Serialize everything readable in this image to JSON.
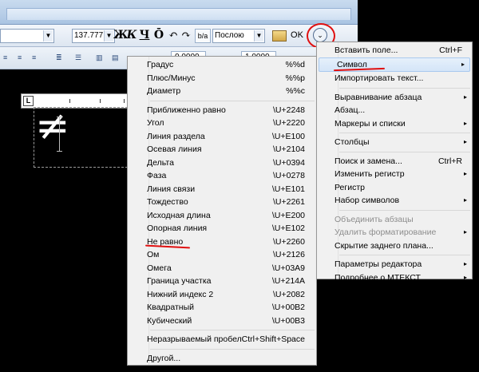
{
  "toolbar": {
    "font_size": "137.777",
    "bold_glyph": "Ж",
    "italic_glyph": "К",
    "underline_glyph": "Ч",
    "overline_glyph": "Ō",
    "undo_glyph": "↶",
    "redo_glyph": "↷",
    "stack_glyph": "b/a",
    "layer": "Послою",
    "ok_label": "OK",
    "options_glyph": "⌄",
    "field1": "0.0000",
    "field2": "1.0000"
  },
  "editor": {
    "ruler_corner": "L",
    "symbol_glyph": "≠"
  },
  "symbol_menu": {
    "items": [
      {
        "label": "Градус",
        "shortcut": "%%d"
      },
      {
        "label": "Плюс/Минус",
        "shortcut": "%%p"
      },
      {
        "label": "Диаметр",
        "shortcut": "%%c"
      },
      {
        "label": "Приближенно равно",
        "shortcut": "\\U+2248"
      },
      {
        "label": "Угол",
        "shortcut": "\\U+2220"
      },
      {
        "label": "Линия раздела",
        "shortcut": "\\U+E100"
      },
      {
        "label": "Осевая линия",
        "shortcut": "\\U+2104"
      },
      {
        "label": "Дельта",
        "shortcut": "\\U+0394"
      },
      {
        "label": "Фаза",
        "shortcut": "\\U+0278"
      },
      {
        "label": "Линия связи",
        "shortcut": "\\U+E101"
      },
      {
        "label": "Тождество",
        "shortcut": "\\U+2261"
      },
      {
        "label": "Исходная длина",
        "shortcut": "\\U+E200"
      },
      {
        "label": "Опорная линия",
        "shortcut": "\\U+E102"
      },
      {
        "label": "Не равно",
        "shortcut": "\\U+2260"
      },
      {
        "label": "Ом",
        "shortcut": "\\U+2126"
      },
      {
        "label": "Омега",
        "shortcut": "\\U+03A9"
      },
      {
        "label": "Граница участка",
        "shortcut": "\\U+214A"
      },
      {
        "label": "Нижний индекс 2",
        "shortcut": "\\U+2082"
      },
      {
        "label": "Квадратный",
        "shortcut": "\\U+00B2"
      },
      {
        "label": "Кубический",
        "shortcut": "\\U+00B3"
      },
      {
        "label": "Неразрываемый пробел",
        "shortcut": "Ctrl+Shift+Space"
      },
      {
        "label": "Другой...",
        "shortcut": ""
      }
    ]
  },
  "main_menu": {
    "items": [
      {
        "label": "Вставить поле...",
        "shortcut": "Ctrl+F",
        "sub": ""
      },
      {
        "label": "Символ",
        "shortcut": "",
        "sub": "▸"
      },
      {
        "label": "Импортировать текст...",
        "shortcut": "",
        "sub": ""
      },
      {
        "label": "Выравнивание абзаца",
        "shortcut": "",
        "sub": "▸"
      },
      {
        "label": "Абзац...",
        "shortcut": "",
        "sub": ""
      },
      {
        "label": "Маркеры и списки",
        "shortcut": "",
        "sub": "▸"
      },
      {
        "label": "Столбцы",
        "shortcut": "",
        "sub": "▸"
      },
      {
        "label": "Поиск и замена...",
        "shortcut": "Ctrl+R",
        "sub": ""
      },
      {
        "label": "Изменить регистр",
        "shortcut": "",
        "sub": "▸"
      },
      {
        "label": "Регистр",
        "shortcut": "",
        "sub": ""
      },
      {
        "label": "Набор символов",
        "shortcut": "",
        "sub": "▸"
      },
      {
        "label": "Объединить абзацы",
        "shortcut": "",
        "sub": ""
      },
      {
        "label": "Удалить форматирование",
        "shortcut": "",
        "sub": "▸"
      },
      {
        "label": "Скрытие заднего плана...",
        "shortcut": "",
        "sub": ""
      },
      {
        "label": "Параметры редактора",
        "shortcut": "",
        "sub": "▸"
      },
      {
        "label": "Подробнее о МТЕКСТ",
        "shortcut": "",
        "sub": "▸"
      }
    ]
  },
  "colors": {
    "annotation_red": "#e01010",
    "menu_bg": "#f0f0f0",
    "highlight": "#d4e5f8"
  }
}
